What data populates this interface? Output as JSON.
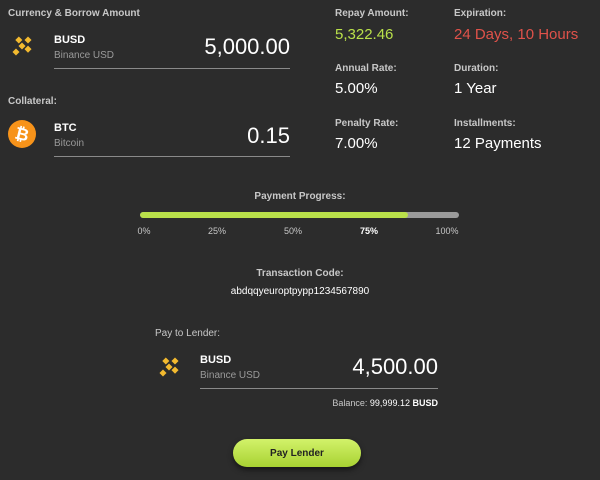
{
  "colors": {
    "background": "#2c2c2c",
    "accent_green": "#b9e04a",
    "accent_red": "#e0524a",
    "busd_yellow": "#f3ba2f",
    "btc_orange": "#f7931a"
  },
  "borrow": {
    "section_label": "Currency & Borrow Amount",
    "coin_symbol": "BUSD",
    "coin_name": "Binance USD",
    "coin_icon": "busd-icon",
    "amount": "5,000.00"
  },
  "collateral": {
    "section_label": "Collateral:",
    "coin_symbol": "BTC",
    "coin_name": "Bitcoin",
    "coin_icon": "bitcoin-icon",
    "amount": "0.15"
  },
  "stats": {
    "repay_amount": {
      "label": "Repay Amount:",
      "value": "5,322.46"
    },
    "expiration": {
      "label": "Expiration:",
      "value": "24 Days, 10 Hours"
    },
    "annual_rate": {
      "label": "Annual Rate:",
      "value": "5.00%"
    },
    "duration": {
      "label": "Duration:",
      "value": "1 Year"
    },
    "penalty_rate": {
      "label": "Penalty Rate:",
      "value": "7.00%"
    },
    "installments": {
      "label": "Installments:",
      "value": "12 Payments"
    }
  },
  "progress": {
    "label": "Payment Progress:",
    "percent": 84,
    "ticks": [
      "0%",
      "25%",
      "50%",
      "75%",
      "100%"
    ],
    "active_tick": "75%"
  },
  "transaction": {
    "label": "Transaction Code:",
    "code": "abdqqyeuroptpypp1234567890"
  },
  "pay": {
    "section_label": "Pay to Lender:",
    "coin_symbol": "BUSD",
    "coin_name": "Binance USD",
    "coin_icon": "busd-icon",
    "amount": "4,500.00",
    "balance_label": "Balance:",
    "balance_value": "99,999.12",
    "balance_unit": "BUSD",
    "button_label": "Pay Lender"
  }
}
